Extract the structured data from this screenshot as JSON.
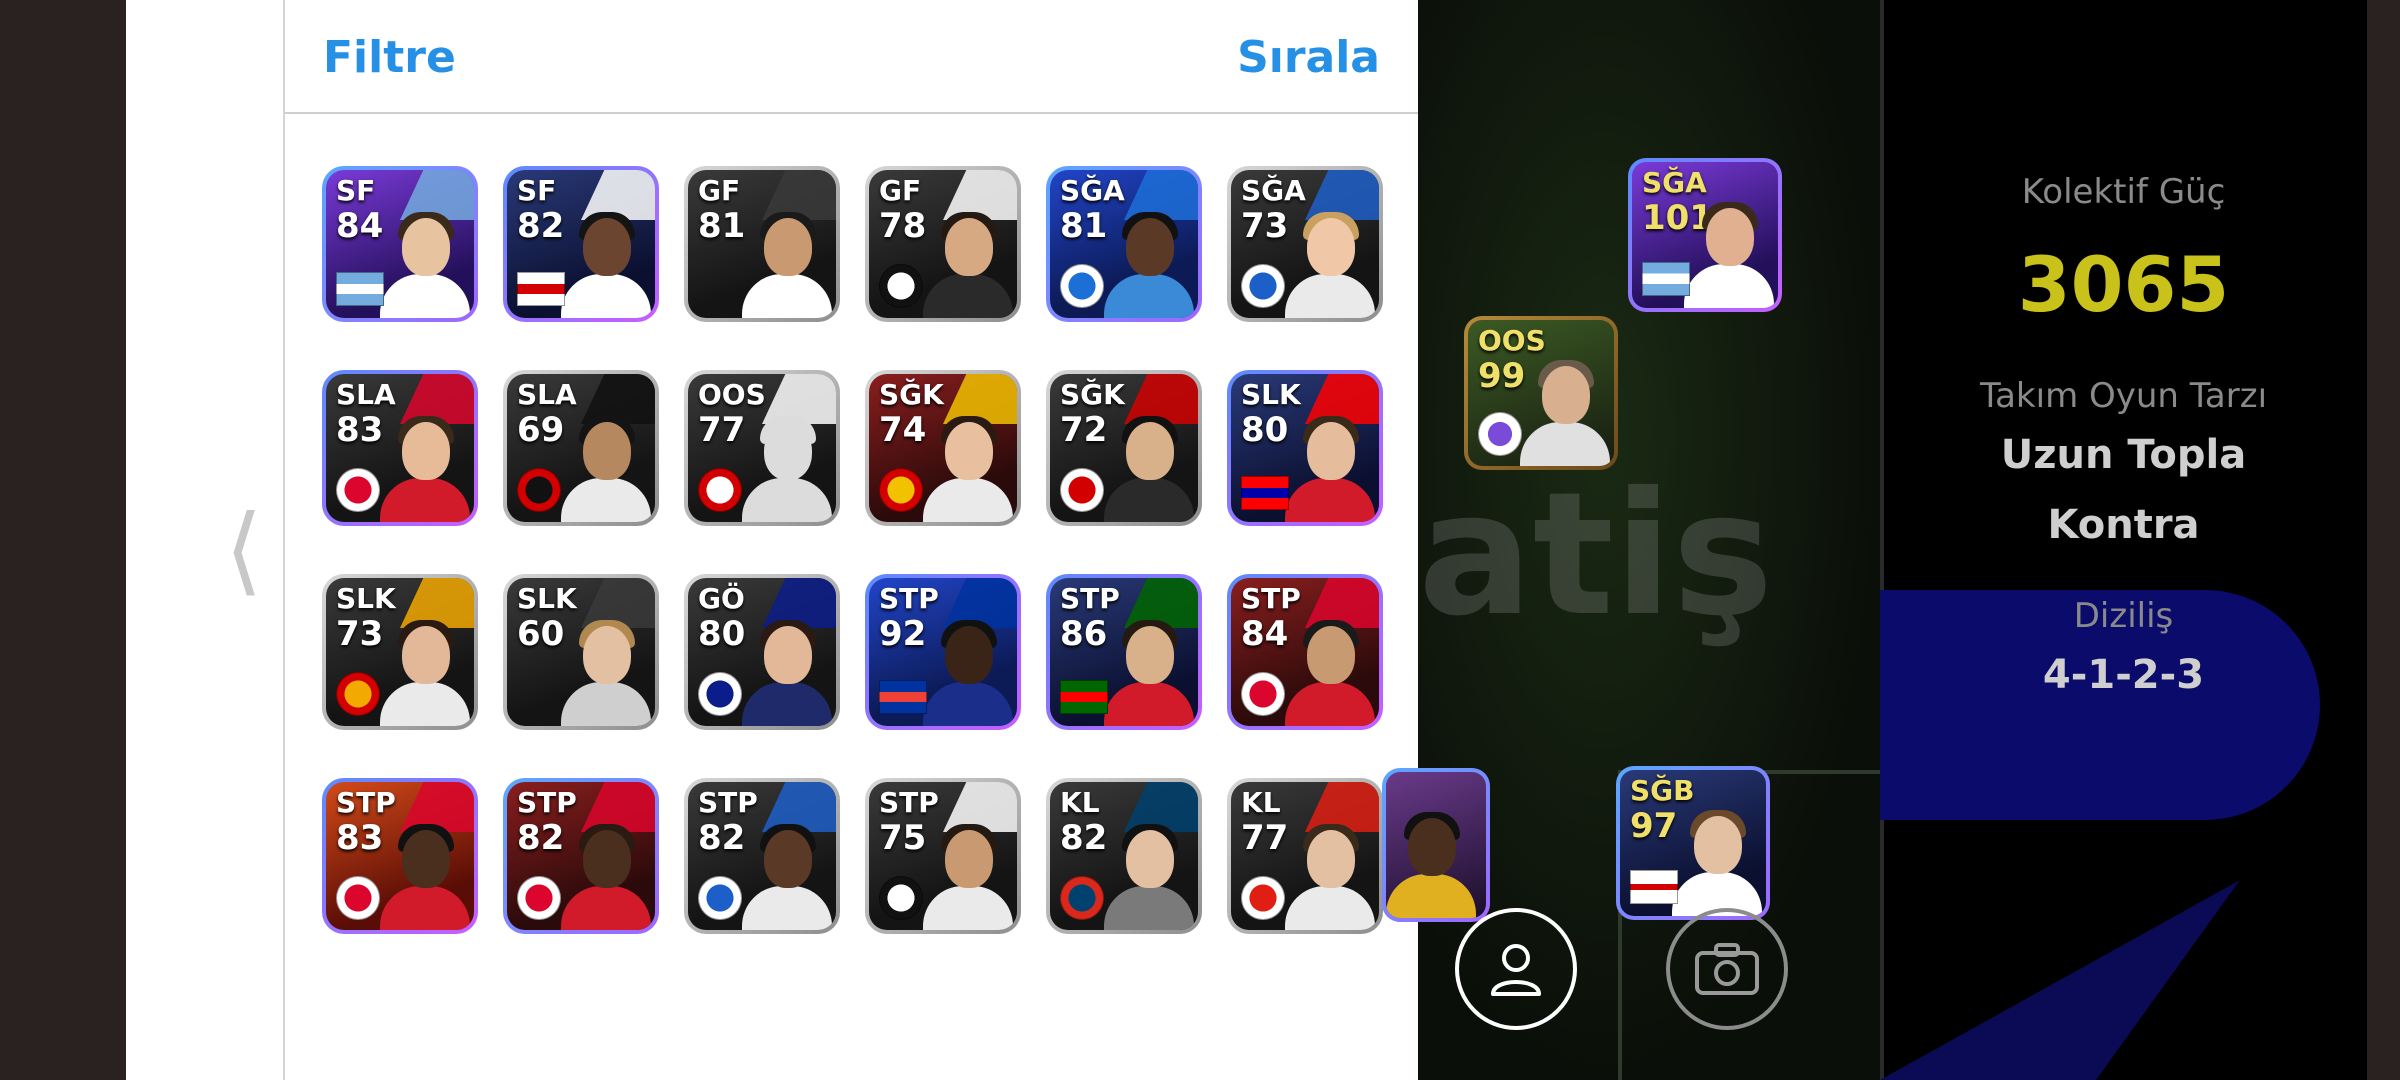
{
  "header": {
    "filter_label": "Filtre",
    "sort_label": "Sırala"
  },
  "players": [
    {
      "pos": "SF",
      "rating": "84",
      "frame": "blue",
      "bg": "purple",
      "skin": "#e8c3a0",
      "hair": "#3a2a1a",
      "kit": "#ffffff",
      "badge": "flag-argentina",
      "badge_colors": [
        "#74acdf",
        "#ffffff"
      ]
    },
    {
      "pos": "SF",
      "rating": "82",
      "frame": "purple",
      "bg": "navy",
      "skin": "#6b4530",
      "hair": "#141414",
      "kit": "#ffffff",
      "badge": "flag-england",
      "badge_colors": [
        "#ffffff",
        "#d20000"
      ]
    },
    {
      "pos": "GF",
      "rating": "81",
      "frame": "silver",
      "bg": "dark",
      "skin": "#c99a72",
      "hair": "#1a1a1a",
      "kit": "#ffffff",
      "badge": "none",
      "badge_colors": [
        "#3a3a3a",
        "#3a3a3a"
      ]
    },
    {
      "pos": "GF",
      "rating": "78",
      "frame": "silver",
      "bg": "dark",
      "skin": "#d7a982",
      "hair": "#241a12",
      "kit": "#2a2a2a",
      "badge": "besiktas-crest",
      "badge_colors": [
        "#ffffff",
        "#111111"
      ]
    },
    {
      "pos": "SĞA",
      "rating": "81",
      "frame": "blue",
      "bg": "blue",
      "skin": "#5a3a26",
      "hair": "#111111",
      "kit": "#3a8ad8",
      "badge": "club-crest",
      "badge_colors": [
        "#1d6fd8",
        "#ffffff"
      ]
    },
    {
      "pos": "SĞA",
      "rating": "73",
      "frame": "silver",
      "bg": "dark",
      "skin": "#f0c8a8",
      "hair": "#c9a060",
      "kit": "#eaeaea",
      "badge": "club-crest",
      "badge_colors": [
        "#1d5fc9",
        "#ffffff"
      ]
    },
    {
      "pos": "SLA",
      "rating": "83",
      "frame": "purple",
      "bg": "dark",
      "skin": "#e8bb98",
      "hair": "#3a2a1a",
      "kit": "#d11a2a",
      "badge": "bayern-crest",
      "badge_colors": [
        "#dc052d",
        "#ffffff"
      ]
    },
    {
      "pos": "SLA",
      "rating": "69",
      "frame": "silver",
      "bg": "dark",
      "skin": "#b58860",
      "hair": "#141414",
      "kit": "#eaeaea",
      "badge": "club-crest",
      "badge_colors": [
        "#111111",
        "#d20000"
      ]
    },
    {
      "pos": "OOS",
      "rating": "77",
      "frame": "silver",
      "bg": "dark",
      "skin": "#dcdcdc",
      "hair": "#dcdcdc",
      "kit": "#dcdcdc",
      "badge": "spfc-crest",
      "badge_colors": [
        "#ffffff",
        "#d20000"
      ]
    },
    {
      "pos": "SĞK",
      "rating": "74",
      "frame": "silver",
      "bg": "red",
      "skin": "#e8c0a0",
      "hair": "#2a1a12",
      "kit": "#eaeaea",
      "badge": "club-crest",
      "badge_colors": [
        "#f2c100",
        "#d20000"
      ]
    },
    {
      "pos": "SĞK",
      "rating": "72",
      "frame": "silver",
      "bg": "dark",
      "skin": "#d8b08a",
      "hair": "#111111",
      "kit": "#2a2a2a",
      "badge": "club-crest",
      "badge_colors": [
        "#d20000",
        "#ffffff"
      ]
    },
    {
      "pos": "SLK",
      "rating": "80",
      "frame": "purple",
      "bg": "navy",
      "skin": "#e6bd9c",
      "hair": "#3a2a1a",
      "kit": "#d11a2a",
      "badge": "flag-croatia",
      "badge_colors": [
        "#ff0000",
        "#0000aa"
      ]
    },
    {
      "pos": "SLK",
      "rating": "73",
      "frame": "silver",
      "bg": "dark",
      "skin": "#e2b898",
      "hair": "#2a1a12",
      "kit": "#eaeaea",
      "badge": "club-crest",
      "badge_colors": [
        "#f2a900",
        "#d20000"
      ]
    },
    {
      "pos": "SLK",
      "rating": "60",
      "frame": "silver",
      "bg": "dark",
      "skin": "#e4c0a2",
      "hair": "#b08850",
      "kit": "#cfcfcf",
      "badge": "none",
      "badge_colors": [
        "#3a3a3a",
        "#3a3a3a"
      ]
    },
    {
      "pos": "GÖ",
      "rating": "80",
      "frame": "silver",
      "bg": "dark",
      "skin": "#e2b898",
      "hair": "#2a1a12",
      "kit": "#1e2a6a",
      "badge": "inter-crest",
      "badge_colors": [
        "#0a1d8a",
        "#ffffff"
      ]
    },
    {
      "pos": "STP",
      "rating": "92",
      "frame": "purple",
      "bg": "blue",
      "skin": "#3a2418",
      "hair": "#111111",
      "kit": "#1b2e8a",
      "badge": "flag-france",
      "badge_colors": [
        "#0033a0",
        "#ef4135"
      ]
    },
    {
      "pos": "STP",
      "rating": "86",
      "frame": "purple",
      "bg": "navy",
      "skin": "#d8b08a",
      "hair": "#241a12",
      "kit": "#d11a2a",
      "badge": "flag-portugal",
      "badge_colors": [
        "#006600",
        "#ff0000"
      ]
    },
    {
      "pos": "STP",
      "rating": "84",
      "frame": "purple",
      "bg": "red",
      "skin": "#c89a72",
      "hair": "#1a1a1a",
      "kit": "#d11a2a",
      "badge": "bayern-crest",
      "badge_colors": [
        "#dc052d",
        "#ffffff"
      ]
    },
    {
      "pos": "STP",
      "rating": "83",
      "frame": "purple",
      "bg": "fire",
      "skin": "#4a2e1e",
      "hair": "#111111",
      "kit": "#d11a2a",
      "badge": "bayern-crest",
      "badge_colors": [
        "#dc052d",
        "#ffffff"
      ]
    },
    {
      "pos": "STP",
      "rating": "82",
      "frame": "blue",
      "bg": "red",
      "skin": "#4a2e1e",
      "hair": "#2a1a12",
      "kit": "#d11a2a",
      "badge": "bayern-crest",
      "badge_colors": [
        "#dc052d",
        "#ffffff"
      ]
    },
    {
      "pos": "STP",
      "rating": "82",
      "frame": "silver",
      "bg": "dark",
      "skin": "#5a3a26",
      "hair": "#111111",
      "kit": "#eaeaea",
      "badge": "club-crest",
      "badge_colors": [
        "#1d5fc9",
        "#ffffff"
      ]
    },
    {
      "pos": "STP",
      "rating": "75",
      "frame": "silver",
      "bg": "dark",
      "skin": "#c99a72",
      "hair": "#241a12",
      "kit": "#eaeaea",
      "badge": "besiktas-crest",
      "badge_colors": [
        "#ffffff",
        "#111111"
      ]
    },
    {
      "pos": "KL",
      "rating": "82",
      "frame": "silver",
      "bg": "dark",
      "skin": "#e4c0a2",
      "hair": "#111111",
      "kit": "#7a7a7a",
      "badge": "psg-crest",
      "badge_colors": [
        "#004170",
        "#da291c"
      ]
    },
    {
      "pos": "KL",
      "rating": "77",
      "frame": "silver",
      "bg": "dark",
      "skin": "#e4c0a2",
      "hair": "#3a2a1a",
      "kit": "#eaeaea",
      "badge": "lille-crest",
      "badge_colors": [
        "#e01e13",
        "#ffffff"
      ]
    }
  ],
  "pitch": {
    "watermark": "atiş",
    "cards": [
      {
        "pos": "SĞA",
        "rating": "101",
        "badge": "flag-argentina"
      },
      {
        "pos": "OOS",
        "rating": "99",
        "badge": "club-crest"
      },
      {
        "pos": "SĞB",
        "rating": "97",
        "badge": "flag-england"
      }
    ]
  },
  "team_info": {
    "power_label": "Kolektif Güç",
    "power_value": "3065",
    "style_label": "Takım Oyun Tarzı",
    "style_value_1": "Uzun Topla",
    "style_value_2": "Kontra",
    "formation_label": "Diziliş",
    "formation_value": "4-1-2-3"
  },
  "colors": {
    "accent_blue": "#2590e6",
    "power_yellow": "#c9c21a"
  }
}
